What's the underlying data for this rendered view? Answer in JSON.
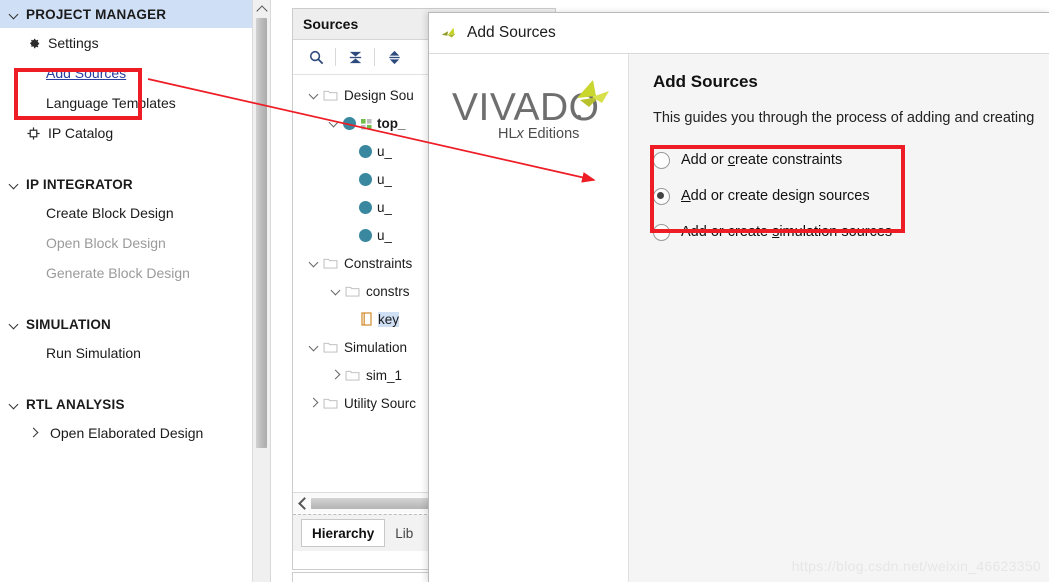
{
  "sidebar": {
    "sections": [
      {
        "name": "project-manager",
        "title": "PROJECT MANAGER",
        "highlighted": true,
        "items": [
          {
            "label": "Settings",
            "icon": "gear-icon",
            "style": "normal"
          },
          {
            "label": "Add Sources",
            "icon": "none",
            "style": "link"
          },
          {
            "label": "Language Templates",
            "icon": "none",
            "style": "normal"
          },
          {
            "label": "IP Catalog",
            "icon": "ip-catalog-icon",
            "style": "normal"
          }
        ]
      },
      {
        "name": "ip-integrator",
        "title": "IP INTEGRATOR",
        "highlighted": false,
        "items": [
          {
            "label": "Create Block Design",
            "icon": "none",
            "style": "normal"
          },
          {
            "label": "Open Block Design",
            "icon": "none",
            "style": "disabled"
          },
          {
            "label": "Generate Block Design",
            "icon": "none",
            "style": "disabled"
          }
        ]
      },
      {
        "name": "simulation",
        "title": "SIMULATION",
        "highlighted": false,
        "items": [
          {
            "label": "Run Simulation",
            "icon": "none",
            "style": "normal"
          }
        ]
      },
      {
        "name": "rtl-analysis",
        "title": "RTL ANALYSIS",
        "highlighted": false,
        "items": [
          {
            "label": "Open Elaborated Design",
            "icon": "chevron-right-icon",
            "style": "normal"
          }
        ]
      }
    ]
  },
  "sources_panel": {
    "title": "Sources",
    "toolbar": [
      {
        "name": "search-icon",
        "label": "Search"
      },
      {
        "name": "collapse-all-icon",
        "label": "Collapse All"
      },
      {
        "name": "expand-all-icon",
        "label": "Expand All"
      }
    ],
    "tree": [
      {
        "label": "Design Sou",
        "indent": 0,
        "chevron": "down",
        "icon": "folder-icon",
        "bold": false,
        "selected": false
      },
      {
        "label": "top_",
        "indent": 1,
        "chevron": "down",
        "icon": "module-icon",
        "bold": true,
        "selected": false
      },
      {
        "label": "u_",
        "indent": 2,
        "chevron": "none",
        "icon": "instance-icon",
        "bold": false,
        "selected": false
      },
      {
        "label": "u_",
        "indent": 2,
        "chevron": "none",
        "icon": "instance-icon",
        "bold": false,
        "selected": false
      },
      {
        "label": "u_",
        "indent": 2,
        "chevron": "none",
        "icon": "instance-icon",
        "bold": false,
        "selected": false
      },
      {
        "label": "u_",
        "indent": 2,
        "chevron": "none",
        "icon": "instance-icon",
        "bold": false,
        "selected": false
      },
      {
        "label": "Constraints",
        "indent": 0,
        "chevron": "down",
        "icon": "folder-icon",
        "bold": false,
        "selected": false
      },
      {
        "label": "constrs",
        "indent": 1,
        "chevron": "down",
        "icon": "folder-icon",
        "bold": false,
        "selected": false
      },
      {
        "label": "key",
        "indent": 2,
        "chevron": "none",
        "icon": "file-icon",
        "bold": false,
        "selected": true
      },
      {
        "label": "Simulation",
        "indent": 0,
        "chevron": "down",
        "icon": "folder-icon",
        "bold": false,
        "selected": false
      },
      {
        "label": "sim_1",
        "indent": 1,
        "chevron": "right",
        "icon": "folder-icon",
        "bold": false,
        "selected": false
      },
      {
        "label": "Utility Sourc",
        "indent": 0,
        "chevron": "right",
        "icon": "folder-icon",
        "bold": false,
        "selected": false
      }
    ],
    "tabs": [
      {
        "label": "Hierarchy",
        "active": true
      },
      {
        "label": "Lib",
        "active": false
      }
    ]
  },
  "dialog": {
    "title": "Add Sources",
    "title_icon": "xilinx-logo-icon",
    "brand": {
      "name": "VIVADO",
      "edition": "HLx Editions"
    },
    "heading": "Add Sources",
    "description": "This guides you through the process of adding and creating",
    "options": [
      {
        "label_pre": "Add or ",
        "mnemonic": "c",
        "label_post": "reate constraints",
        "checked": false,
        "name": "add-or-create-constraints"
      },
      {
        "label_pre": "",
        "mnemonic": "A",
        "label_post": "dd or create design sources",
        "checked": true,
        "name": "add-or-create-design-sources"
      },
      {
        "label_pre": "Add or create ",
        "mnemonic": "s",
        "label_post": "imulation sources",
        "checked": false,
        "name": "add-or-create-simulation-sources"
      }
    ]
  },
  "annotations": {
    "accent_color": "#ee1c25",
    "watermark": "https://blog.csdn.net/weixin_46623350"
  }
}
